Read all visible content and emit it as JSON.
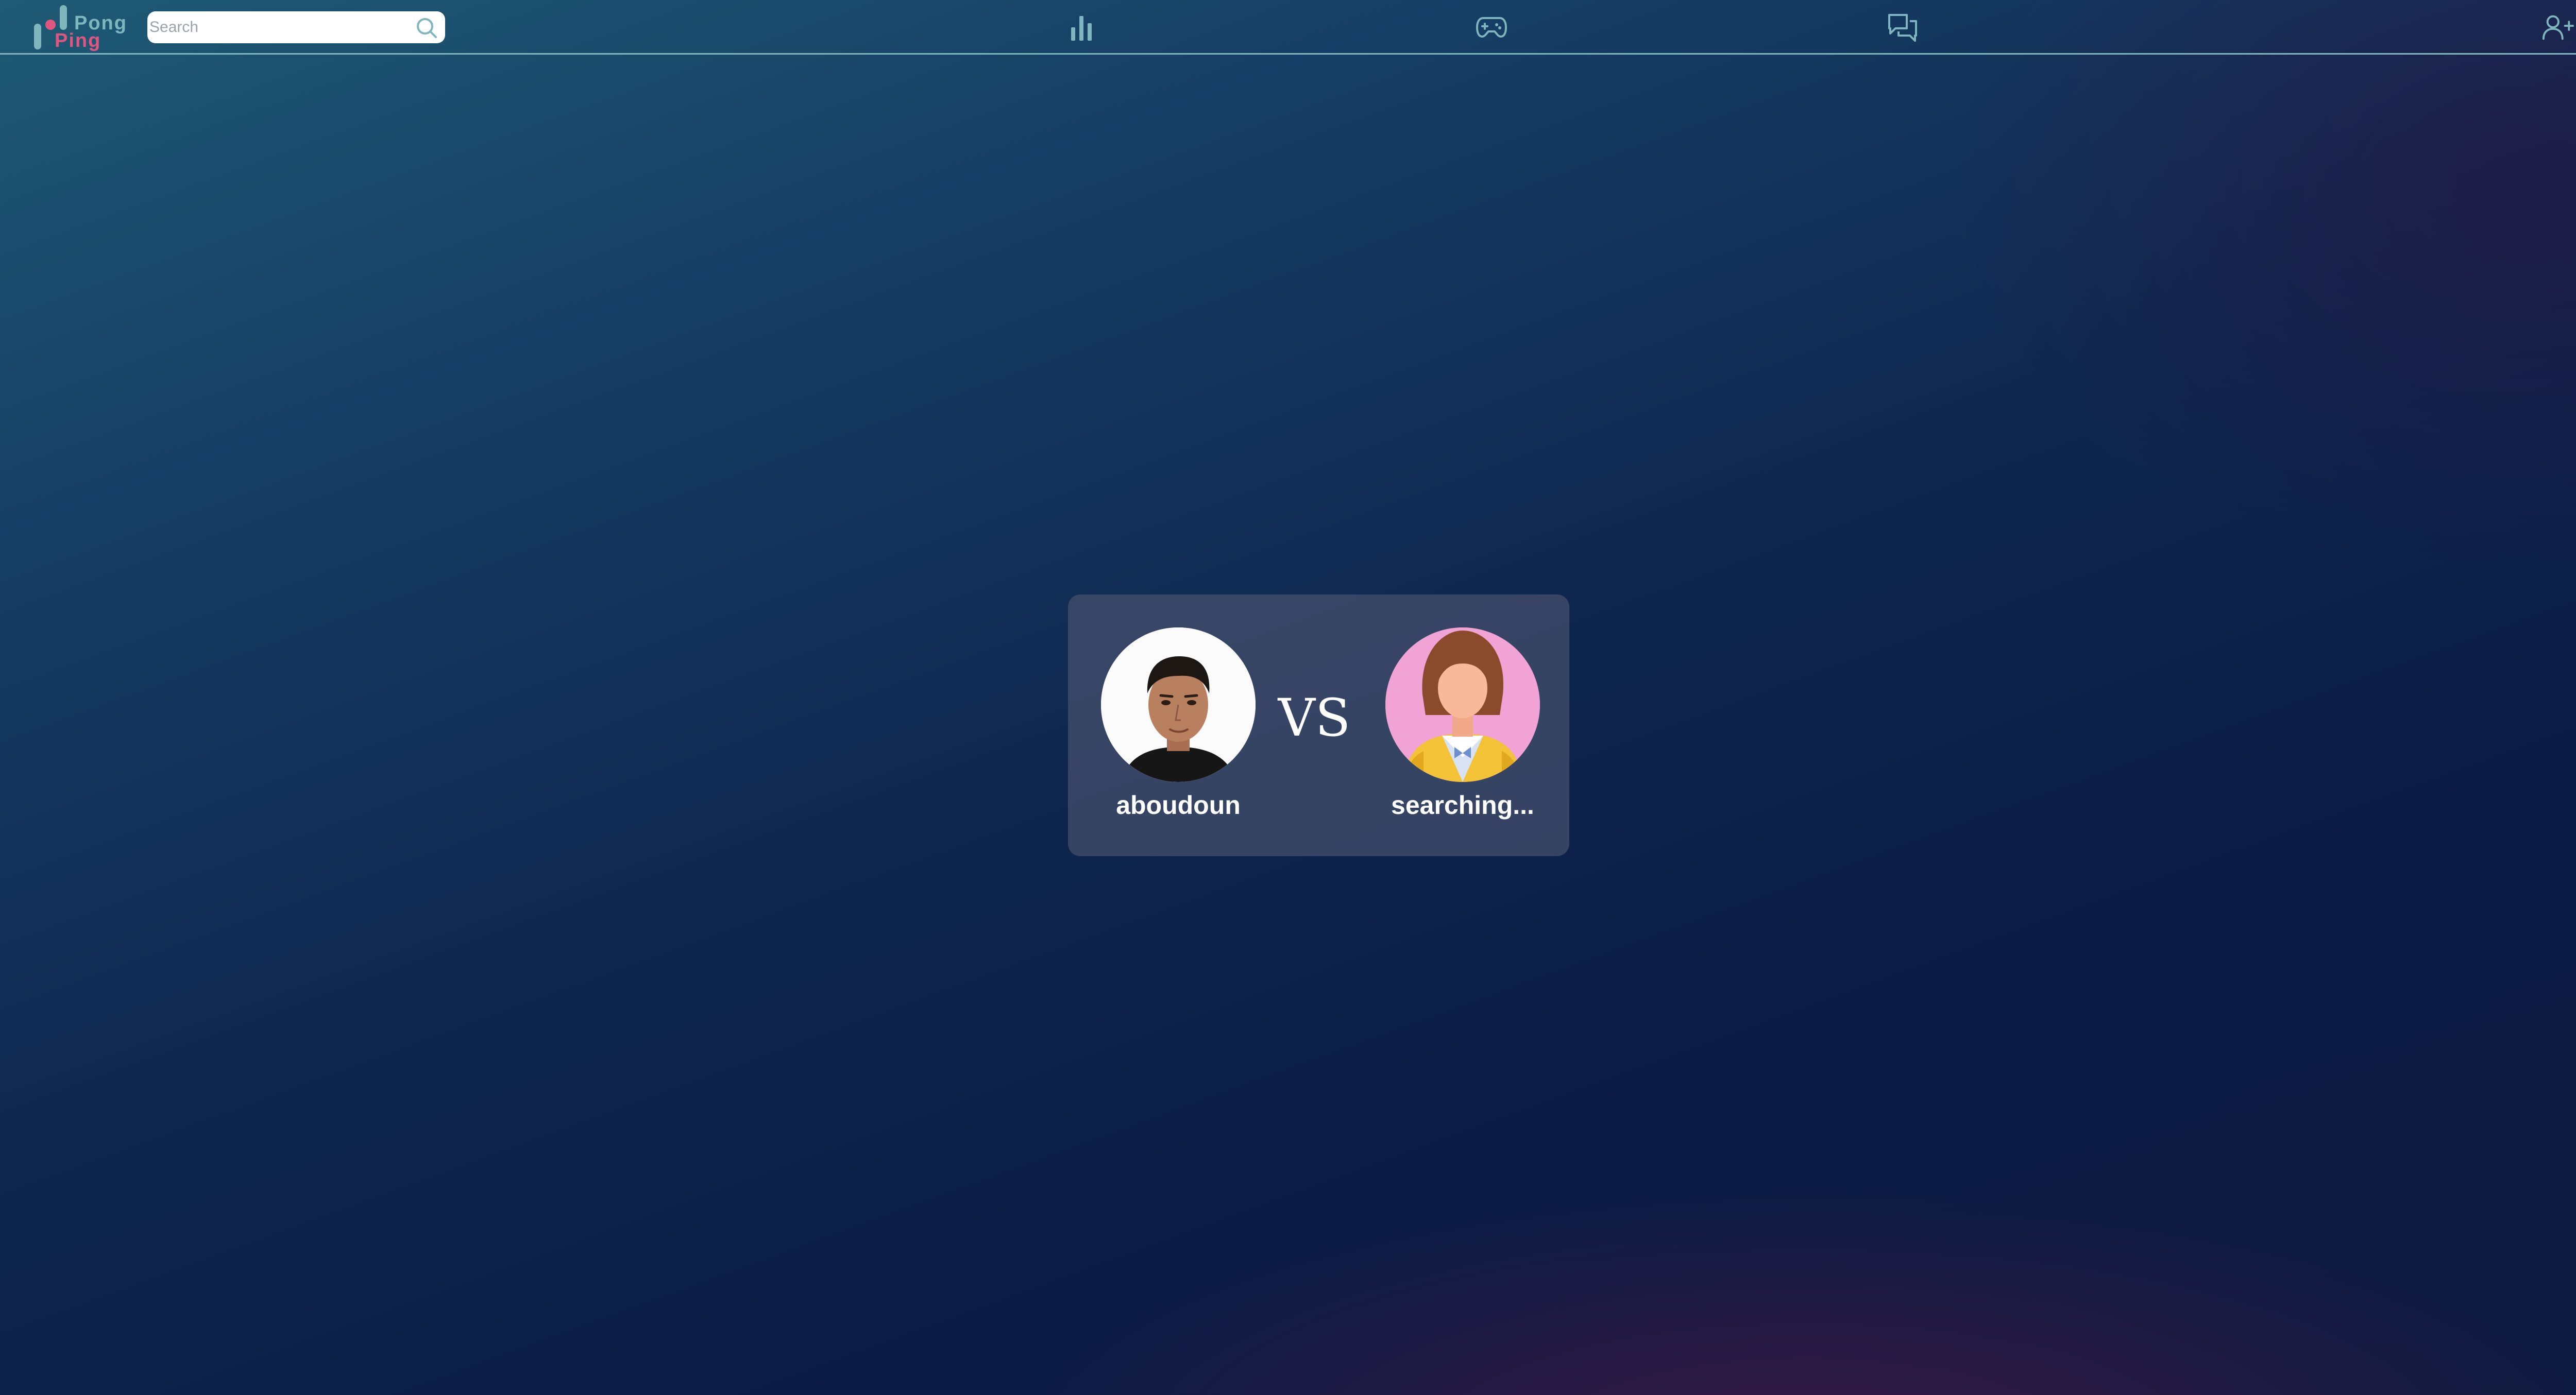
{
  "brand": {
    "name_top": "Pong",
    "name_bottom": "Ping"
  },
  "search": {
    "placeholder": "Search"
  },
  "nav": {
    "icons": [
      "bar-chart-icon",
      "gamepad-icon",
      "chat-icon"
    ]
  },
  "header_actions": {
    "icons": [
      "add-user-icon",
      "avatar"
    ]
  },
  "match": {
    "player_one": {
      "name": "aboudoun"
    },
    "versus_label": "VS",
    "player_two": {
      "name": "searching..."
    }
  },
  "colors": {
    "accent_teal": "#7fb6be",
    "accent_pink": "#e05680",
    "card_background": "#46506e"
  }
}
